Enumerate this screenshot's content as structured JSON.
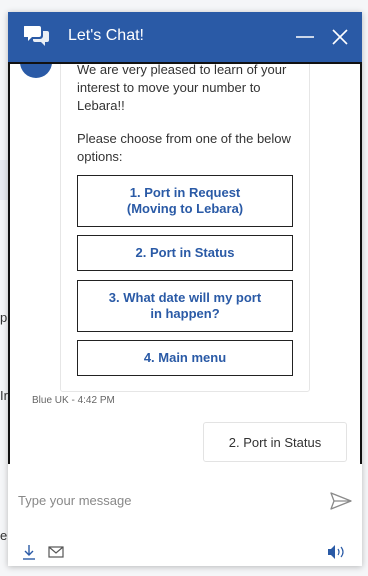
{
  "background": {
    "fragments": [
      "p",
      "Ir",
      "e"
    ]
  },
  "header": {
    "title": "Let's Chat!",
    "icons": {
      "chat": "chat-bubbles-icon",
      "minimize": "minimize-icon",
      "close": "close-icon"
    }
  },
  "transcript": {
    "bot_message": {
      "lines": [
        "We are very pleased to learn of your",
        "interest to move your number to",
        "Lebara!!"
      ],
      "prompt_lines": [
        "Please choose from one of the below",
        "options:"
      ],
      "options": [
        {
          "line1": "1. Port in Request",
          "line2": "(Moving to Lebara)"
        },
        {
          "line1": "2. Port in Status",
          "line2": ""
        },
        {
          "line1": "3. What date will my port",
          "line2": "in happen?"
        },
        {
          "line1": "4. Main menu",
          "line2": ""
        }
      ],
      "meta": "Blue UK - 4:42 PM"
    },
    "user_message": "2. Port in Status"
  },
  "composer": {
    "placeholder": "Type your message",
    "icons": {
      "send": "send-icon",
      "download": "download-icon",
      "email": "email-icon",
      "sound": "speaker-icon"
    }
  },
  "colors": {
    "header": "#2a5aa6",
    "accent_text": "#2a5aa6",
    "border": "#111111"
  }
}
